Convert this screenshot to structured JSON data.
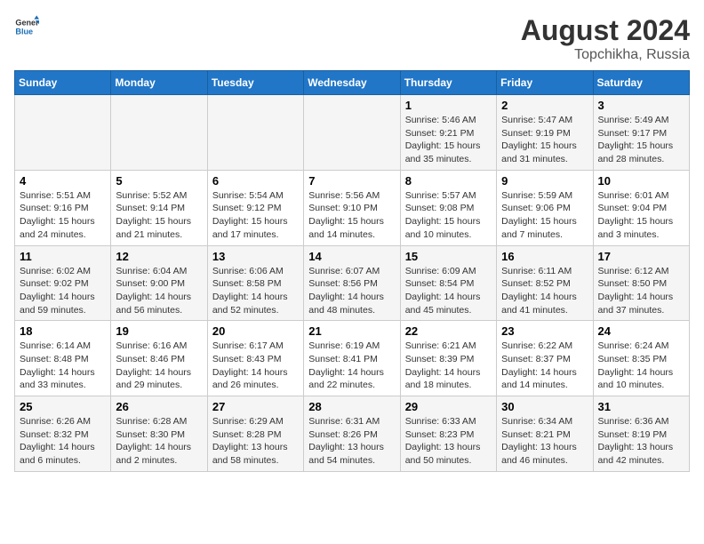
{
  "header": {
    "logo_general": "General",
    "logo_blue": "Blue",
    "title": "August 2024",
    "subtitle": "Topchikha, Russia"
  },
  "days_of_week": [
    "Sunday",
    "Monday",
    "Tuesday",
    "Wednesday",
    "Thursday",
    "Friday",
    "Saturday"
  ],
  "weeks": [
    [
      {
        "day": "",
        "info": ""
      },
      {
        "day": "",
        "info": ""
      },
      {
        "day": "",
        "info": ""
      },
      {
        "day": "",
        "info": ""
      },
      {
        "day": "1",
        "info": "Sunrise: 5:46 AM\nSunset: 9:21 PM\nDaylight: 15 hours\nand 35 minutes."
      },
      {
        "day": "2",
        "info": "Sunrise: 5:47 AM\nSunset: 9:19 PM\nDaylight: 15 hours\nand 31 minutes."
      },
      {
        "day": "3",
        "info": "Sunrise: 5:49 AM\nSunset: 9:17 PM\nDaylight: 15 hours\nand 28 minutes."
      }
    ],
    [
      {
        "day": "4",
        "info": "Sunrise: 5:51 AM\nSunset: 9:16 PM\nDaylight: 15 hours\nand 24 minutes."
      },
      {
        "day": "5",
        "info": "Sunrise: 5:52 AM\nSunset: 9:14 PM\nDaylight: 15 hours\nand 21 minutes."
      },
      {
        "day": "6",
        "info": "Sunrise: 5:54 AM\nSunset: 9:12 PM\nDaylight: 15 hours\nand 17 minutes."
      },
      {
        "day": "7",
        "info": "Sunrise: 5:56 AM\nSunset: 9:10 PM\nDaylight: 15 hours\nand 14 minutes."
      },
      {
        "day": "8",
        "info": "Sunrise: 5:57 AM\nSunset: 9:08 PM\nDaylight: 15 hours\nand 10 minutes."
      },
      {
        "day": "9",
        "info": "Sunrise: 5:59 AM\nSunset: 9:06 PM\nDaylight: 15 hours\nand 7 minutes."
      },
      {
        "day": "10",
        "info": "Sunrise: 6:01 AM\nSunset: 9:04 PM\nDaylight: 15 hours\nand 3 minutes."
      }
    ],
    [
      {
        "day": "11",
        "info": "Sunrise: 6:02 AM\nSunset: 9:02 PM\nDaylight: 14 hours\nand 59 minutes."
      },
      {
        "day": "12",
        "info": "Sunrise: 6:04 AM\nSunset: 9:00 PM\nDaylight: 14 hours\nand 56 minutes."
      },
      {
        "day": "13",
        "info": "Sunrise: 6:06 AM\nSunset: 8:58 PM\nDaylight: 14 hours\nand 52 minutes."
      },
      {
        "day": "14",
        "info": "Sunrise: 6:07 AM\nSunset: 8:56 PM\nDaylight: 14 hours\nand 48 minutes."
      },
      {
        "day": "15",
        "info": "Sunrise: 6:09 AM\nSunset: 8:54 PM\nDaylight: 14 hours\nand 45 minutes."
      },
      {
        "day": "16",
        "info": "Sunrise: 6:11 AM\nSunset: 8:52 PM\nDaylight: 14 hours\nand 41 minutes."
      },
      {
        "day": "17",
        "info": "Sunrise: 6:12 AM\nSunset: 8:50 PM\nDaylight: 14 hours\nand 37 minutes."
      }
    ],
    [
      {
        "day": "18",
        "info": "Sunrise: 6:14 AM\nSunset: 8:48 PM\nDaylight: 14 hours\nand 33 minutes."
      },
      {
        "day": "19",
        "info": "Sunrise: 6:16 AM\nSunset: 8:46 PM\nDaylight: 14 hours\nand 29 minutes."
      },
      {
        "day": "20",
        "info": "Sunrise: 6:17 AM\nSunset: 8:43 PM\nDaylight: 14 hours\nand 26 minutes."
      },
      {
        "day": "21",
        "info": "Sunrise: 6:19 AM\nSunset: 8:41 PM\nDaylight: 14 hours\nand 22 minutes."
      },
      {
        "day": "22",
        "info": "Sunrise: 6:21 AM\nSunset: 8:39 PM\nDaylight: 14 hours\nand 18 minutes."
      },
      {
        "day": "23",
        "info": "Sunrise: 6:22 AM\nSunset: 8:37 PM\nDaylight: 14 hours\nand 14 minutes."
      },
      {
        "day": "24",
        "info": "Sunrise: 6:24 AM\nSunset: 8:35 PM\nDaylight: 14 hours\nand 10 minutes."
      }
    ],
    [
      {
        "day": "25",
        "info": "Sunrise: 6:26 AM\nSunset: 8:32 PM\nDaylight: 14 hours\nand 6 minutes."
      },
      {
        "day": "26",
        "info": "Sunrise: 6:28 AM\nSunset: 8:30 PM\nDaylight: 14 hours\nand 2 minutes."
      },
      {
        "day": "27",
        "info": "Sunrise: 6:29 AM\nSunset: 8:28 PM\nDaylight: 13 hours\nand 58 minutes."
      },
      {
        "day": "28",
        "info": "Sunrise: 6:31 AM\nSunset: 8:26 PM\nDaylight: 13 hours\nand 54 minutes."
      },
      {
        "day": "29",
        "info": "Sunrise: 6:33 AM\nSunset: 8:23 PM\nDaylight: 13 hours\nand 50 minutes."
      },
      {
        "day": "30",
        "info": "Sunrise: 6:34 AM\nSunset: 8:21 PM\nDaylight: 13 hours\nand 46 minutes."
      },
      {
        "day": "31",
        "info": "Sunrise: 6:36 AM\nSunset: 8:19 PM\nDaylight: 13 hours\nand 42 minutes."
      }
    ]
  ]
}
